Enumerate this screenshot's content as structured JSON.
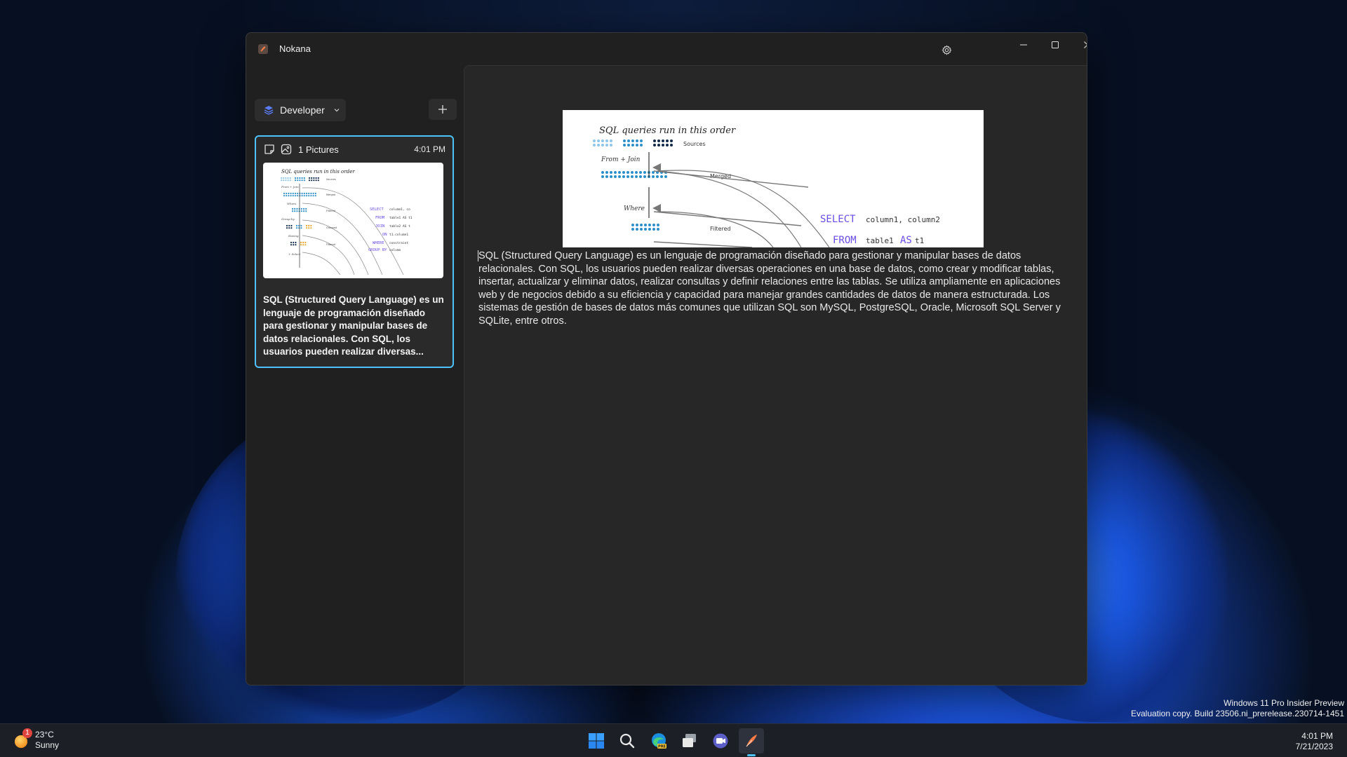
{
  "app": {
    "title": "Nokana"
  },
  "sidebar": {
    "notebook_label": "Developer",
    "note": {
      "count_label": "1 Pictures",
      "time": "4:01 PM",
      "preview_text": "SQL (Structured Query Language) es un lenguaje de programación diseñado para gestionar y manipular bases de datos relacionales. Con SQL, los usuarios pueden realizar diversas..."
    }
  },
  "image": {
    "title": "SQL queries run in this order",
    "labels": [
      "Sources",
      "Merged",
      "Filtered"
    ],
    "steps": [
      "From + Join",
      "Where"
    ],
    "code": [
      {
        "kw": "SELECT",
        "text": "column1, column2"
      },
      {
        "kw": "FROM",
        "text": "table1",
        "kw2": "AS",
        "text2": "t1"
      }
    ],
    "thumb_code": [
      "SELECT",
      "FROM",
      "JOIN",
      "ON",
      "WHERE",
      "GROUP BY"
    ],
    "thumb_steps": [
      "From + Join",
      "Where",
      "Group by",
      "Having",
      "+ Select"
    ],
    "thumb_labels": [
      "Sources",
      "Merged",
      "Filtered",
      "Grouped",
      "Filtered"
    ],
    "thumb_code_text": [
      "column1, co",
      "table1 AS t1",
      "table2 AS t",
      "t1.column1",
      "constraint",
      "column"
    ]
  },
  "content": {
    "body": "SQL (Structured Query Language) es un lenguaje de programación diseñado para gestionar y manipular bases de datos relacionales. Con SQL, los usuarios pueden realizar diversas operaciones en una base de datos, como crear y modificar tablas, insertar, actualizar y eliminar datos, realizar consultas y definir relaciones entre las tablas. Se utiliza ampliamente en aplicaciones web y de negocios debido a su eficiencia y capacidad para manejar grandes cantidades de datos de manera estructurada. Los sistemas de gestión de bases de datos más comunes que utilizan SQL son MySQL, PostgreSQL, Oracle, Microsoft SQL Server y SQLite, entre otros."
  },
  "watermark": {
    "line1": "Windows 11 Pro Insider Preview",
    "line2": "Evaluation copy. Build 23506.ni_prerelease.230714-1451"
  },
  "taskbar": {
    "weather_temp": "23°C",
    "weather_desc": "Sunny",
    "weather_badge": "1",
    "time": "4:01 PM",
    "date": "7/21/2023",
    "icons": [
      "start-icon",
      "search-icon",
      "edge-icon",
      "task-view-icon",
      "teams-icon",
      "nokana-icon"
    ]
  },
  "colors": {
    "accent": "#4cc2ff",
    "sql_keyword": "#6b4ce6",
    "dot_light": "#8ec6e8",
    "dot_mid": "#2b8fc8",
    "dot_dark": "#0f2a48"
  }
}
